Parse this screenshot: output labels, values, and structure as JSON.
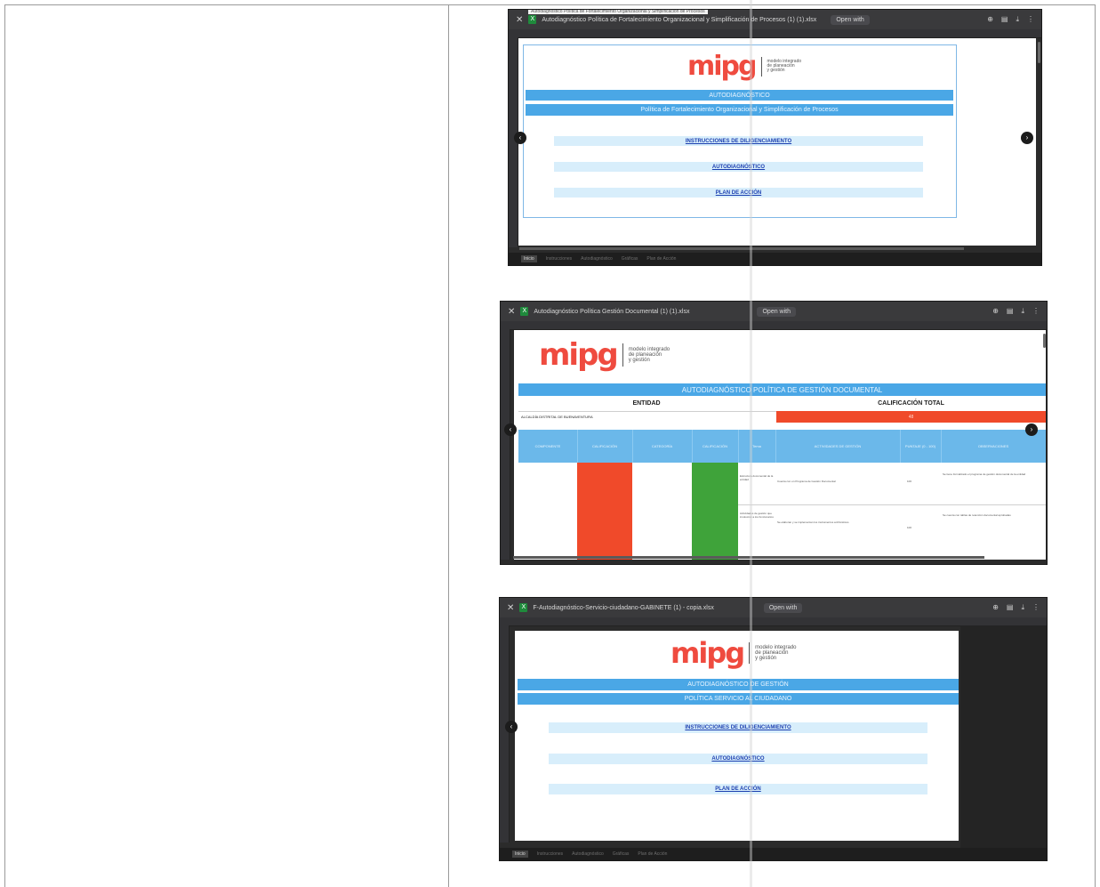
{
  "screens": [
    {
      "file_title": "Autodiagnóstico Política de Fortalecimiento Organizacional y Simplificación de Procesos (1) (1).xlsx",
      "open_with": "Open with",
      "tooltip": "Autodiagnóstico Política de Fortalecimiento Organizacional y Simplificación de Procesos",
      "logo_word": "mipg",
      "logo_tagline": "modelo integrado\nde planeación\ny gestión",
      "banner_1": "AUTODIAGNÓSTICO",
      "banner_2": "Política de Fortalecimiento Organizacional y Simplificación de Procesos",
      "links": [
        "INSTRUCCIONES DE DILIGENCIAMIENTO",
        "AUTODIAGNÓSTICO",
        "PLAN DE ACCIÓN"
      ],
      "sheet_tabs": [
        "Inicio",
        "Instrucciones",
        "Autodiagnóstico",
        "Gráficas",
        "Plan de Acción"
      ]
    },
    {
      "file_title": "Autodiagnóstico Política Gestión Documental (1) (1).xlsx",
      "open_with": "Open with",
      "logo_word": "mipg",
      "logo_tagline": "modelo integrado\nde planeación\ny gestión",
      "banner": "AUTODIAGNÓSTICO POLÍTICA DE GESTIÓN DOCUMENTAL",
      "entity_label": "ENTIDAD",
      "entity_value": "ALCALDÍA DISTRITAL DE BUENAVENTURA",
      "score_label": "CALIFICACIÓN TOTAL",
      "score_value": "48",
      "table_headers": [
        "COMPONENTE",
        "CALIFICACIÓN",
        "CATEGORÍA",
        "CALIFICACIÓN",
        "Tema",
        "ACTIVIDADES DE GESTIÓN",
        "PUNTAJE (0 - 100)",
        "OBSERVACIONES"
      ],
      "row_1": {
        "tema": "Estructura documental de la entidad",
        "actividad": "Cuenta con un Programa de Gestión Documental",
        "puntaje": "100",
        "observacion": "Se tiene formalizado el programa de gestión documental de la entidad"
      },
      "row_2": {
        "tema": "Actividades de gestión que involucran a los funcionarios",
        "actividad": "Se elaboran y se implementan los instrumentos archivísticos",
        "puntaje": "100",
        "observacion": "Se cuenta con tablas de retención documental aprobadas"
      },
      "colors": {
        "orange": "#f04a2a",
        "green": "#3fa33a",
        "header_blue": "#6bb8ea"
      }
    },
    {
      "file_title": "F-Autodiagnóstico-Servicio-ciudadano-GABINETE (1) - copia.xlsx",
      "open_with": "Open with",
      "logo_word": "mipg",
      "logo_tagline": "modelo integrado\nde planeación\ny gestión",
      "banner_1": "AUTODIAGNÓSTICO DE GESTIÓN",
      "banner_2": "POLÍTICA SERVICIO AL CIUDADANO",
      "links": [
        "INSTRUCCIONES DE DILIGENCIAMIENTO",
        "AUTODIAGNÓSTICO",
        "PLAN DE ACCIÓN"
      ],
      "sheet_tabs": [
        "Inicio",
        "Instrucciones",
        "Autodiagnóstico",
        "Gráficas",
        "Plan de Acción"
      ]
    }
  ]
}
